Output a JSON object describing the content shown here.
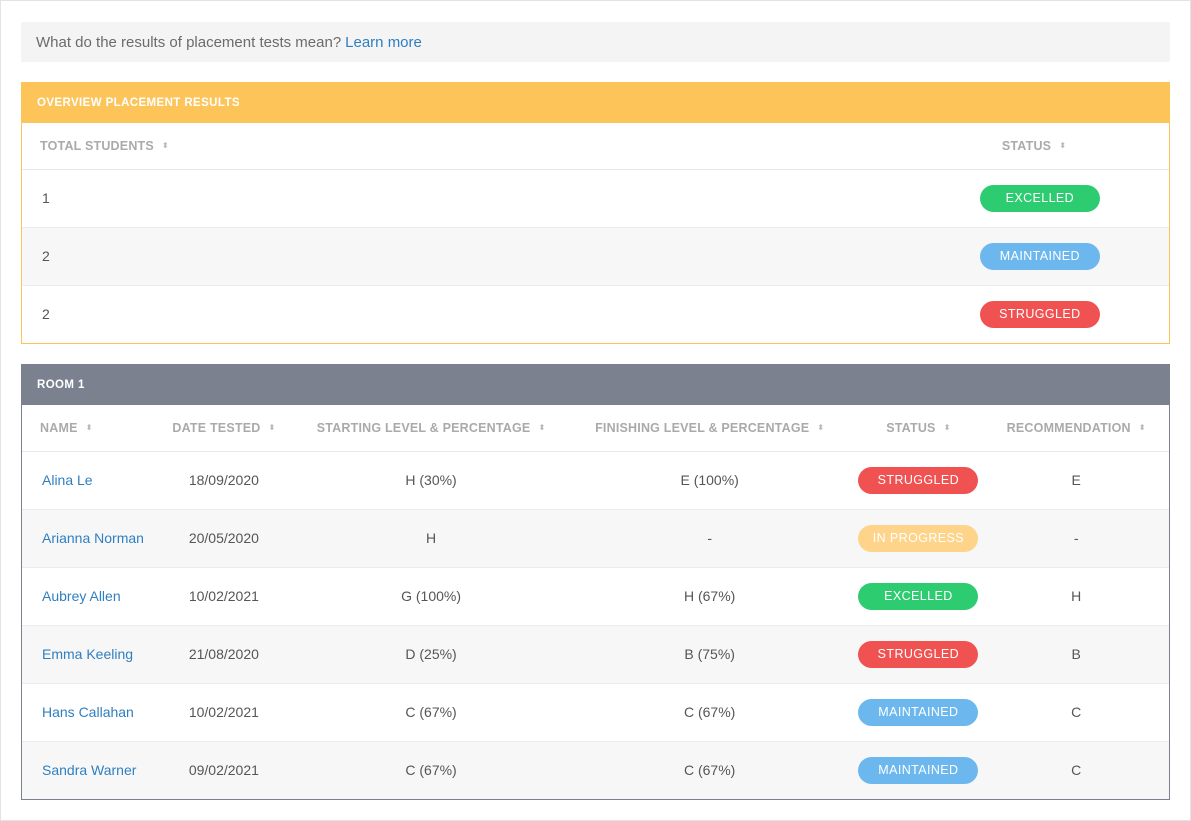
{
  "info": {
    "question": "What do the results of placement tests mean?",
    "link": "Learn more"
  },
  "overview": {
    "title": "OVERVIEW PLACEMENT RESULTS",
    "headers": {
      "total": "TOTAL STUDENTS",
      "status": "STATUS"
    },
    "rows": [
      {
        "total": "1",
        "status": "EXCELLED",
        "color": "#2ecc71"
      },
      {
        "total": "2",
        "status": "MAINTAINED",
        "color": "#6cb8ee"
      },
      {
        "total": "2",
        "status": "STRUGGLED",
        "color": "#f05252"
      }
    ]
  },
  "room": {
    "title": "ROOM 1",
    "headers": {
      "name": "NAME",
      "date": "DATE TESTED",
      "start": "STARTING LEVEL & PERCENTAGE",
      "finish": "FINISHING LEVEL & PERCENTAGE",
      "status": "STATUS",
      "rec": "RECOMMENDATION"
    },
    "rows": [
      {
        "name": "Alina Le",
        "date": "18/09/2020",
        "start": "H (30%)",
        "finish": "E (100%)",
        "status": "STRUGGLED",
        "color": "#f05252",
        "rec": "E"
      },
      {
        "name": "Arianna Norman",
        "date": "20/05/2020",
        "start": "H",
        "finish": "-",
        "status": "IN PROGRESS",
        "color": "#fdd48a",
        "rec": "-"
      },
      {
        "name": "Aubrey Allen",
        "date": "10/02/2021",
        "start": "G (100%)",
        "finish": "H (67%)",
        "status": "EXCELLED",
        "color": "#2ecc71",
        "rec": "H"
      },
      {
        "name": "Emma Keeling",
        "date": "21/08/2020",
        "start": "D (25%)",
        "finish": "B (75%)",
        "status": "STRUGGLED",
        "color": "#f05252",
        "rec": "B"
      },
      {
        "name": "Hans Callahan",
        "date": "10/02/2021",
        "start": "C (67%)",
        "finish": "C (67%)",
        "status": "MAINTAINED",
        "color": "#6cb8ee",
        "rec": "C"
      },
      {
        "name": "Sandra Warner",
        "date": "09/02/2021",
        "start": "C (67%)",
        "finish": "C (67%)",
        "status": "MAINTAINED",
        "color": "#6cb8ee",
        "rec": "C"
      }
    ]
  }
}
